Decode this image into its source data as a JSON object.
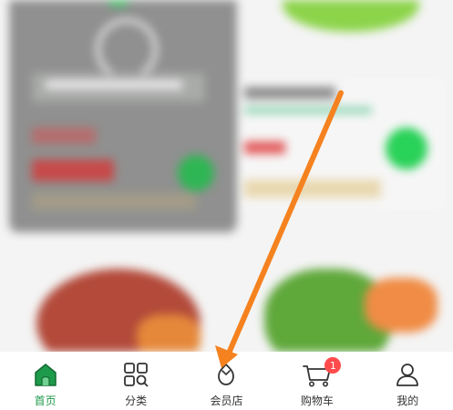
{
  "tabbar": {
    "tabs": [
      {
        "label": "首页",
        "icon": "home-icon",
        "active": true
      },
      {
        "label": "分类",
        "icon": "category-grid-icon",
        "active": false
      },
      {
        "label": "会员店",
        "icon": "member-store-icon",
        "active": false
      },
      {
        "label": "购物车",
        "icon": "shopping-cart-icon",
        "active": false,
        "badge": "1"
      },
      {
        "label": "我的",
        "icon": "profile-icon",
        "active": false
      }
    ]
  },
  "colors": {
    "accent_green": "#1e9a4b",
    "badge_red": "#ff4b4b",
    "arrow_orange": "#f5821f"
  }
}
